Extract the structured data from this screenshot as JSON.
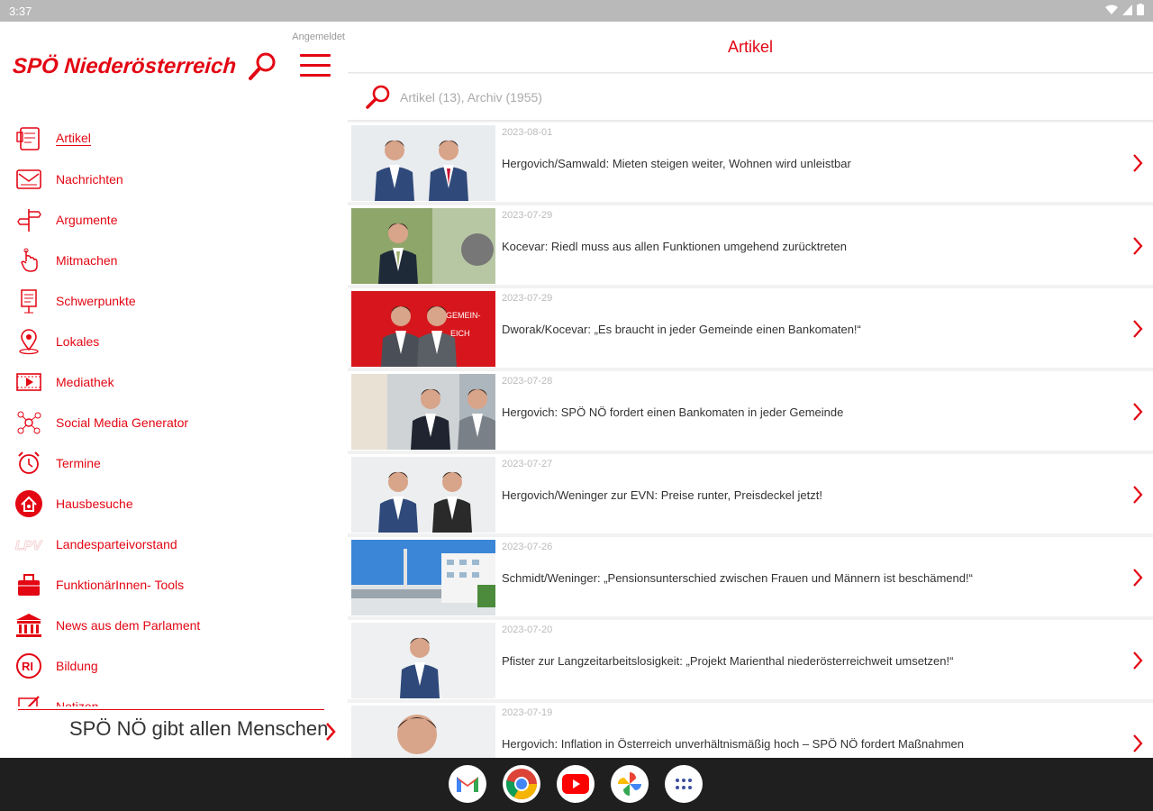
{
  "status_bar": {
    "time": "3:37"
  },
  "sidebar": {
    "logged_in": "Angemeldet",
    "logo_text": "SPÖ Niederösterreich",
    "items": [
      {
        "label": "Artikel",
        "icon": "article-icon",
        "active": true
      },
      {
        "label": "Nachrichten",
        "icon": "mail-icon"
      },
      {
        "label": "Argumente",
        "icon": "signpost-icon"
      },
      {
        "label": "Mitmachen",
        "icon": "hand-pointer-icon"
      },
      {
        "label": "Schwerpunkte",
        "icon": "easel-icon"
      },
      {
        "label": "Lokales",
        "icon": "map-pin-icon"
      },
      {
        "label": "Mediathek",
        "icon": "video-icon"
      },
      {
        "label": "Social Media Generator",
        "icon": "social-network-icon"
      },
      {
        "label": "Termine",
        "icon": "alarm-clock-icon"
      },
      {
        "label": "Hausbesuche",
        "icon": "house-visit-icon"
      },
      {
        "label": "Landesparteivorstand",
        "icon": "lpv-icon"
      },
      {
        "label": "FunktionärInnen- Tools",
        "icon": "toolbox-icon"
      },
      {
        "label": "News aus dem Parlament",
        "icon": "parliament-icon"
      },
      {
        "label": "Bildung",
        "icon": "education-icon"
      },
      {
        "label": "Notizen",
        "icon": "notes-icon"
      }
    ],
    "ticker_text": "SPÖ NÖ gibt allen Menschen"
  },
  "main": {
    "title": "Artikel",
    "search_placeholder": "Artikel (13), Archiv (1955)",
    "articles": [
      {
        "date": "2023-08-01",
        "title": "Hergovich/Samwald: Mieten steigen weiter, Wohnen wird unleistbar"
      },
      {
        "date": "2023-07-29",
        "title": "Kocevar: Riedl muss aus allen Funktionen umgehend zurücktreten"
      },
      {
        "date": "2023-07-29",
        "title": "Dworak/Kocevar: „Es braucht in jeder Gemeinde einen Bankomaten!“"
      },
      {
        "date": "2023-07-28",
        "title": "Hergovich: SPÖ NÖ fordert einen Bankomaten in jeder Gemeinde"
      },
      {
        "date": "2023-07-27",
        "title": "Hergovich/Weninger zur EVN: Preise runter, Preisdeckel jetzt!"
      },
      {
        "date": "2023-07-26",
        "title": "Schmidt/Weninger: „Pensionsunterschied zwischen Frauen und Männern ist beschämend!“"
      },
      {
        "date": "2023-07-20",
        "title": "Pfister zur Langzeitarbeitslosigkeit: „Projekt Marienthal niederösterreichweit umsetzen!“"
      },
      {
        "date": "2023-07-19",
        "title": "Hergovich: Inflation in Österreich unverhältnismäßig hoch – SPÖ NÖ fordert Maßnahmen"
      }
    ]
  },
  "dock": [
    "gmail-icon",
    "chrome-icon",
    "youtube-icon",
    "photos-icon",
    "app-drawer-icon"
  ],
  "colors": {
    "accent": "#e30613",
    "background": "#f2f2f2",
    "taskbar": "#1f1f1f"
  }
}
